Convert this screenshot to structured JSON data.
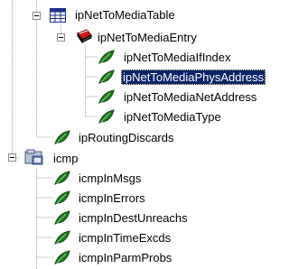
{
  "tree": {
    "nodes": [
      {
        "label": "ipNetToMediaTable",
        "icon": "table-icon",
        "expanded": true
      },
      {
        "label": "ipNetToMediaEntry",
        "icon": "entry-icon",
        "expanded": true
      },
      {
        "label": "ipNetToMediaIfIndex",
        "icon": "leaf-icon"
      },
      {
        "label": "ipNetToMediaPhysAddress",
        "icon": "leaf-icon",
        "selected": true
      },
      {
        "label": "ipNetToMediaNetAddress",
        "icon": "leaf-icon"
      },
      {
        "label": "ipNetToMediaType",
        "icon": "leaf-icon"
      },
      {
        "label": "ipRoutingDiscards",
        "icon": "leaf-icon"
      },
      {
        "label": "icmp",
        "icon": "folder-icon",
        "expanded": true
      },
      {
        "label": "icmpInMsgs",
        "icon": "leaf-icon"
      },
      {
        "label": "icmpInErrors",
        "icon": "leaf-icon"
      },
      {
        "label": "icmpInDestUnreachs",
        "icon": "leaf-icon"
      },
      {
        "label": "icmpInTimeExcds",
        "icon": "leaf-icon"
      },
      {
        "label": "icmpInParmProbs",
        "icon": "leaf-icon"
      }
    ]
  },
  "colors": {
    "selection_bg": "#0a246a",
    "selection_text": "#ffffff",
    "leaf_green": "#1f7a1f",
    "tree_lines": "#a0a0a0"
  }
}
